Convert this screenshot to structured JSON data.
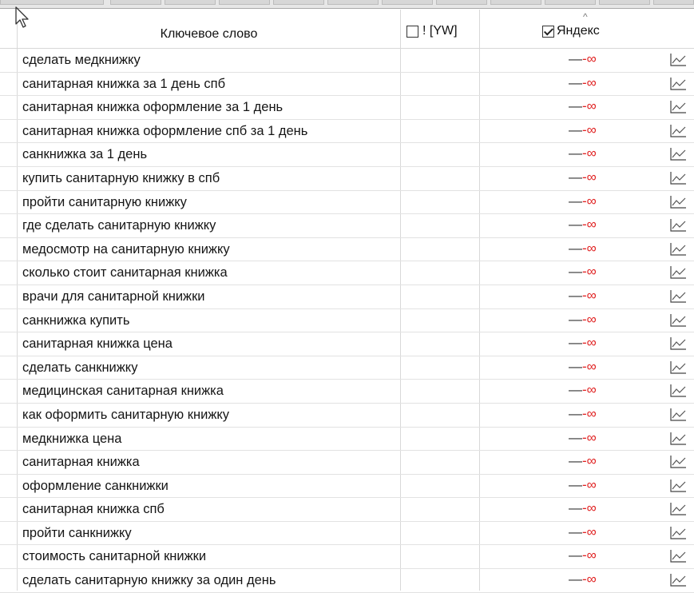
{
  "columns": {
    "keyword": "Ключевое слово",
    "yw": "! [YW]",
    "yandex": "Яндекс",
    "yw_checked": false,
    "yandex_checked": true,
    "sort_indicator": "^"
  },
  "value": {
    "dash": "—",
    "inf": "-∞"
  },
  "colors": {
    "negative_infinity": "#e02020",
    "grid_line": "#d8d8d8"
  },
  "icons": {
    "chart": "chart-line-icon",
    "checkbox": "checkbox-icon",
    "cursor": "mouse-cursor-icon"
  },
  "rows": [
    "сделать медкнижку",
    "санитарная книжка за 1 день спб",
    "санитарная книжка оформление за 1 день",
    "санитарная книжка оформление спб за 1 день",
    "санкнижка за 1 день",
    "купить санитарную книжку в спб",
    "пройти санитарную книжку",
    "где сделать санитарную книжку",
    "медосмотр на санитарную книжку",
    "сколько стоит санитарная книжка",
    "врачи для санитарной книжки",
    "санкнижка купить",
    "санитарная книжка цена",
    "сделать санкнижку",
    "медицинская санитарная книжка",
    "как оформить санитарную книжку",
    "медкнижка цена",
    "санитарная книжка",
    "оформление санкнижки",
    "санитарная книжка спб",
    "пройти санкнижку",
    "стоимость санитарной книжки",
    "сделать санитарную книжку за один день"
  ]
}
